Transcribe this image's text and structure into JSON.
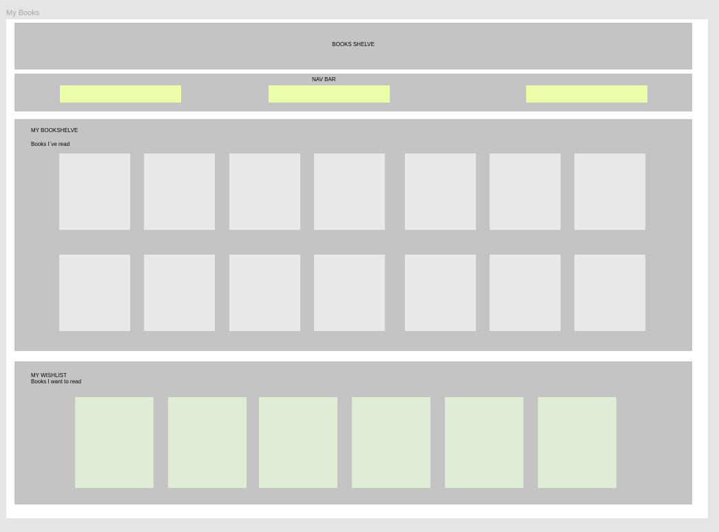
{
  "page": {
    "frame_label": "My Books"
  },
  "header": {
    "title": "BOOKS SHELVE"
  },
  "navbar": {
    "title": "NAV BAR",
    "buttons": [
      {
        "label": ""
      },
      {
        "label": ""
      },
      {
        "label": ""
      }
    ]
  },
  "bookshelf": {
    "title": "MY BOOKSHELVE",
    "subtitle": "Books I´ve read",
    "rows": 2,
    "cards_per_row": 7
  },
  "wishlist": {
    "title": "MY WISHLIST",
    "subtitle": "Books I want to read",
    "cards": 6
  },
  "colors": {
    "background": "#e5e5e5",
    "frame": "#ffffff",
    "panel": "#c4c4c4",
    "nav_button": "#ebffab",
    "book_card": "#eae8e8",
    "wish_card": "#dfedd6"
  }
}
